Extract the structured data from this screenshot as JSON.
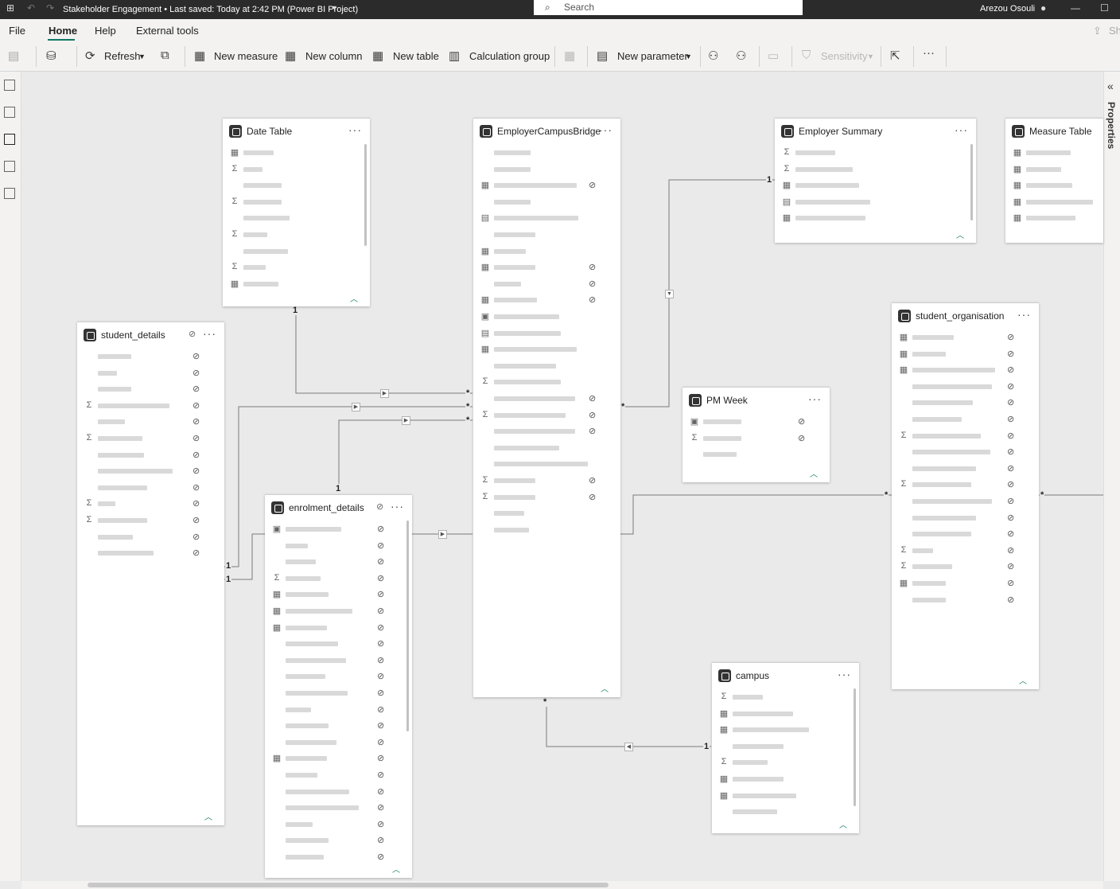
{
  "titlebar": {
    "title": "Stakeholder Engagement • Last saved: Today at 2:42 PM (Power BI Project)",
    "search_placeholder": "Search",
    "user": "Arezou Osouli"
  },
  "menu": [
    "File",
    "Home",
    "Help",
    "External tools"
  ],
  "ribbon": {
    "refresh": "Refresh",
    "new_measure": "New measure",
    "new_column": "New column",
    "new_table": "New table",
    "calculation_group": "Calculation group",
    "new_parameter": "New parameter",
    "sensitivity": "Sensitivity",
    "share": "Sh"
  },
  "properties_label": "Properties",
  "tables": {
    "date_table": "Date Table",
    "bridge": "EmployerCampusBridge",
    "employer_summary": "Employer Summary",
    "measure_table": "Measure Table",
    "student_details": "student_details",
    "student_org": "student_organisation",
    "pm_week": "PM Week",
    "enrolment": "enrolment_details",
    "campus": "campus"
  },
  "cardinality": {
    "one": "1",
    "many": "*"
  },
  "colors": {
    "accent": "#117865",
    "line": "#7a7a7a",
    "canvas": "#eaeaea"
  },
  "icons": [
    "search-icon",
    "table-icon",
    "sigma-icon",
    "calendar-icon",
    "hidden-eye-icon",
    "more-icon",
    "collapse-chevron-icon"
  ]
}
